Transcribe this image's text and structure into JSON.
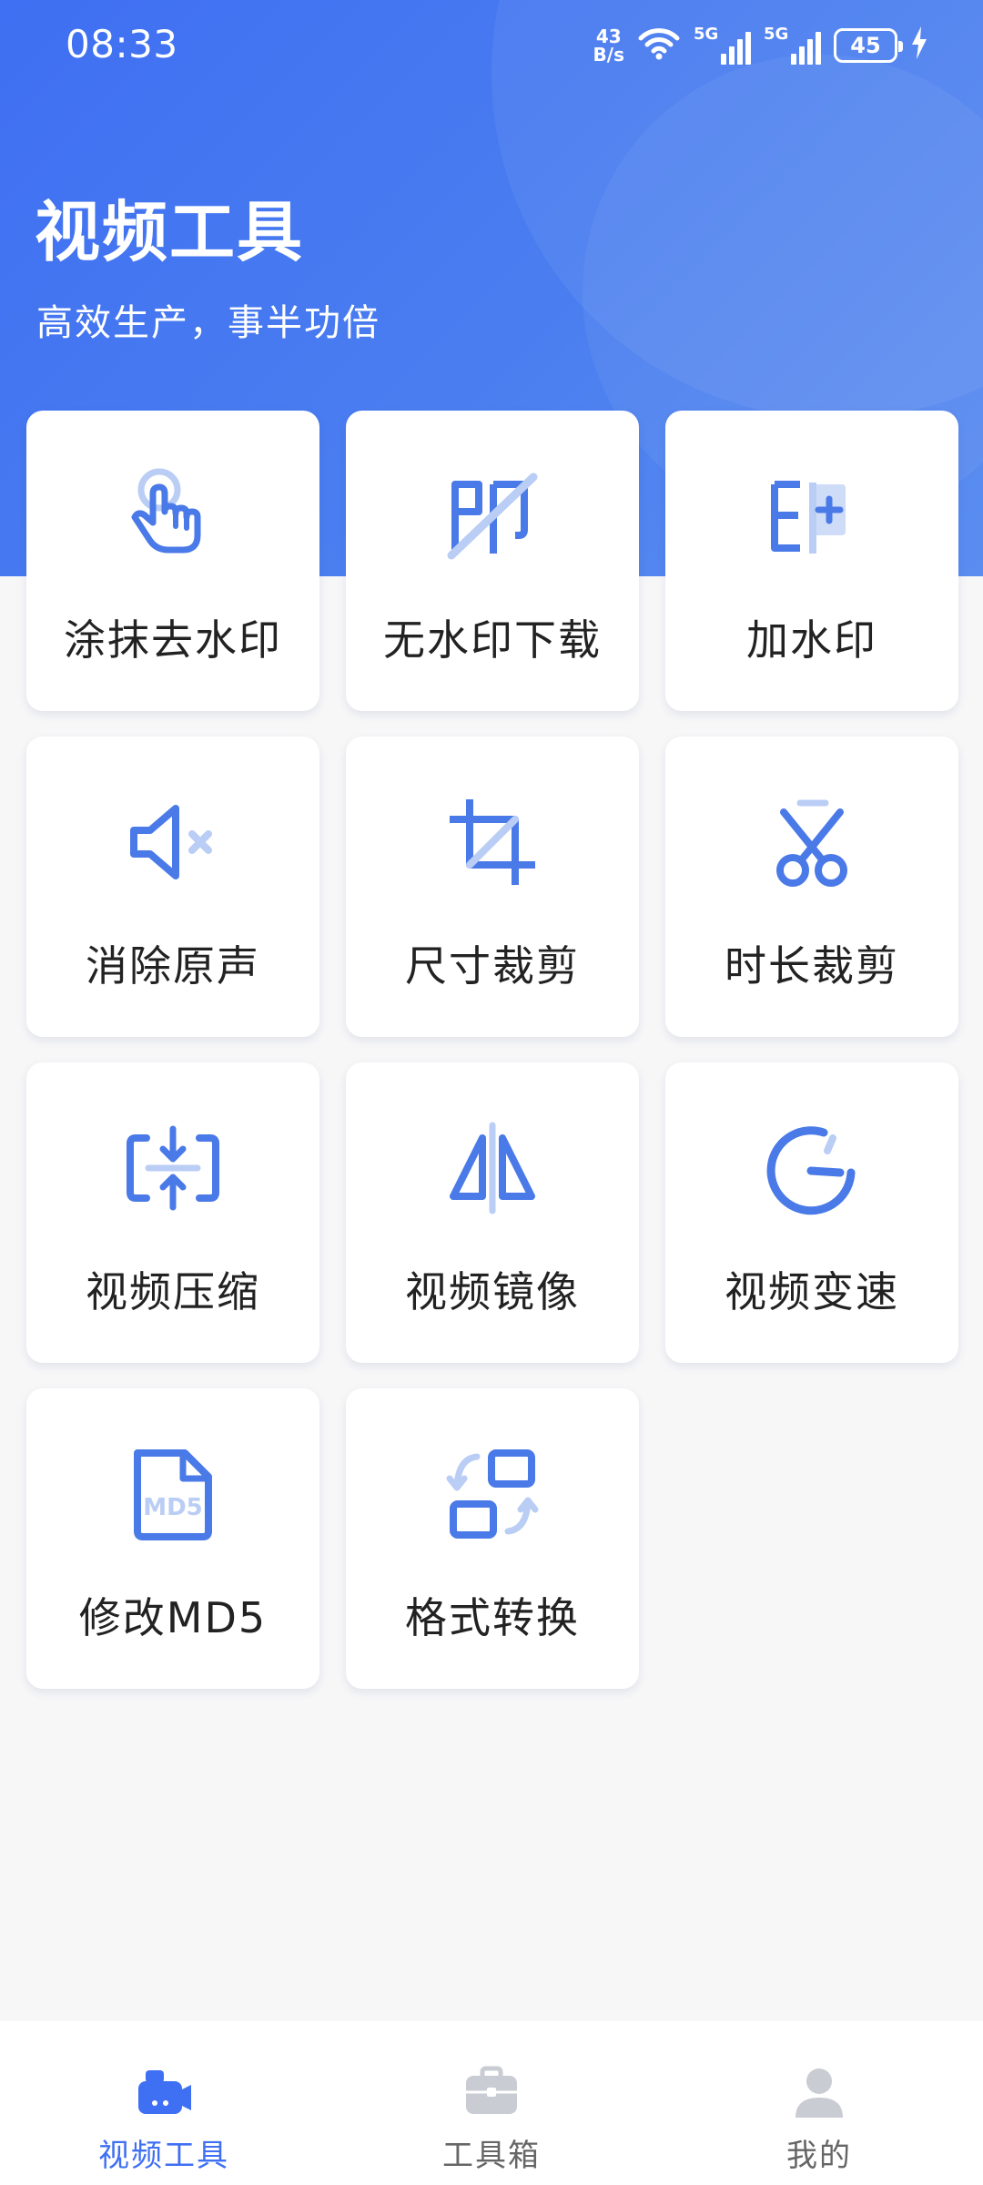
{
  "status_bar": {
    "time": "08:33",
    "net_speed_value": "43",
    "net_speed_unit": "B/s",
    "sim1_label": "5G",
    "sim2_label": "5G",
    "battery": "45"
  },
  "header": {
    "title": "视频工具",
    "subtitle": "高效生产，事半功倍"
  },
  "tools": [
    {
      "label": "涂抹去水印",
      "icon": "tap-hand-icon"
    },
    {
      "label": "无水印下载",
      "icon": "no-watermark-icon"
    },
    {
      "label": "加水印",
      "icon": "add-watermark-icon"
    },
    {
      "label": "消除原声",
      "icon": "mute-icon"
    },
    {
      "label": "尺寸裁剪",
      "icon": "crop-icon"
    },
    {
      "label": "时长裁剪",
      "icon": "scissors-icon"
    },
    {
      "label": "视频压缩",
      "icon": "compress-icon"
    },
    {
      "label": "视频镜像",
      "icon": "mirror-icon"
    },
    {
      "label": "视频变速",
      "icon": "speed-gauge-icon"
    },
    {
      "label": "修改MD5",
      "icon": "md5-file-icon"
    },
    {
      "label": "格式转换",
      "icon": "format-convert-icon"
    }
  ],
  "bottom_nav": [
    {
      "label": "视频工具",
      "icon": "video-camera-icon",
      "active": true
    },
    {
      "label": "工具箱",
      "icon": "toolbox-icon",
      "active": false
    },
    {
      "label": "我的",
      "icon": "user-icon",
      "active": false
    }
  ],
  "colors": {
    "accent": "#3f6ff2",
    "icon_blue": "#4a79e8",
    "icon_light": "#b9cdf5",
    "card_bg": "#ffffff",
    "page_bg": "#f7f7f8"
  }
}
